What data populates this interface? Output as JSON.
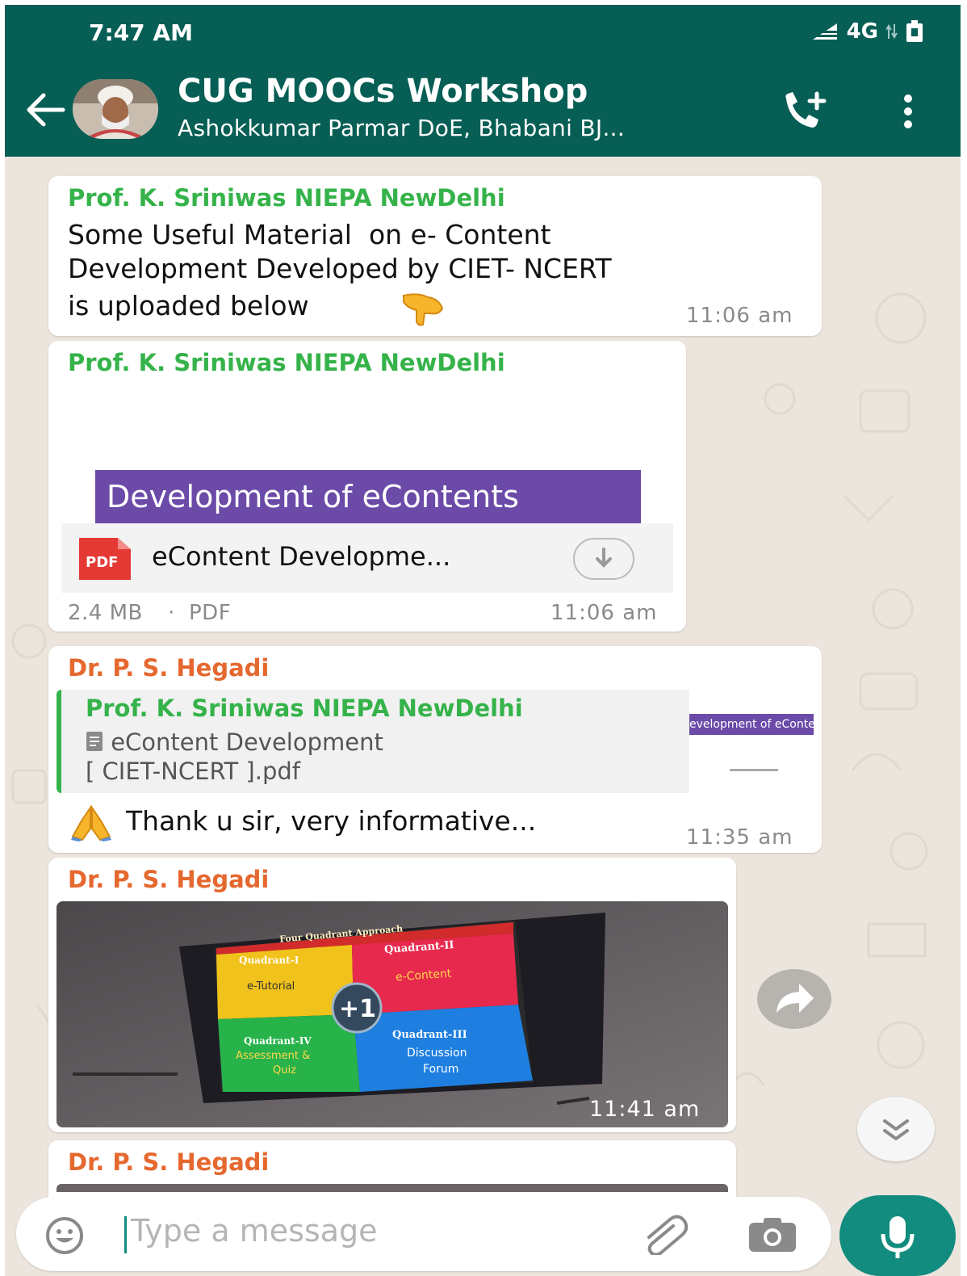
{
  "status_bar": {
    "time": "7:47 AM",
    "network": "4G"
  },
  "header": {
    "title": "CUG MOOCs Workshop",
    "subtitle": "Ashokkumar Parmar DoE, Bhabani BJ..."
  },
  "messages": [
    {
      "sender": "Prof. K. Sriniwas NIEPA NewDelhi",
      "lines": [
        "Some Useful Material  on e- Content",
        "Development Developed by CIET- NCERT",
        "is uploaded below"
      ],
      "time": "11:06 am"
    },
    {
      "sender": "Prof. K. Sriniwas NIEPA NewDelhi",
      "preview_banner": "Development of eContents",
      "pdf_badge": "PDF",
      "file_name": "eContent Developme...",
      "file_size": "2.4 MB",
      "file_type": "PDF",
      "time": "11:06 am"
    },
    {
      "sender": "Dr. P. S. Hegadi",
      "quote_sender": "Prof. K. Sriniwas NIEPA NewDelhi",
      "quote_line1": "eContent Development",
      "quote_line2": "[ CIET-NCERT ].pdf",
      "quote_thumb_text": "evelopment of eConte",
      "text": "Thank u sir, very informative...",
      "time": "11:35 am"
    },
    {
      "sender": "Dr. P. S. Hegadi",
      "photo": {
        "heading": "Four Quadrant Approach",
        "q1_title": "Quadrant-I",
        "q1_label": "e-Tutorial",
        "q2_title": "Quadrant-II",
        "q2_label": "e-Content",
        "q3_title": "Quadrant-III",
        "q3_label1": "Discussion",
        "q3_label2": "Forum",
        "q4_title": "Quadrant-IV",
        "q4_label1": "Assessment &",
        "q4_label2": "Quiz",
        "center": "+1"
      },
      "time": "11:41 am"
    },
    {
      "sender": "Dr. P. S. Hegadi"
    }
  ],
  "composer": {
    "placeholder": "Type a message"
  },
  "colors": {
    "header": "#075e54",
    "accent": "#128c7e",
    "chat_bg": "#ece5dd",
    "sender_green": "#35b34a",
    "sender_orange": "#e5682f",
    "banner_purple": "#6b4aa8"
  },
  "icons": [
    "back-arrow-icon",
    "add-call-icon",
    "more-vert-icon",
    "pointing-hand-emoji",
    "pdf-icon",
    "download-icon",
    "document-icon",
    "folded-hands-emoji",
    "share-icon",
    "scroll-down-icon",
    "emoji-icon",
    "attach-icon",
    "camera-icon",
    "mic-icon"
  ]
}
